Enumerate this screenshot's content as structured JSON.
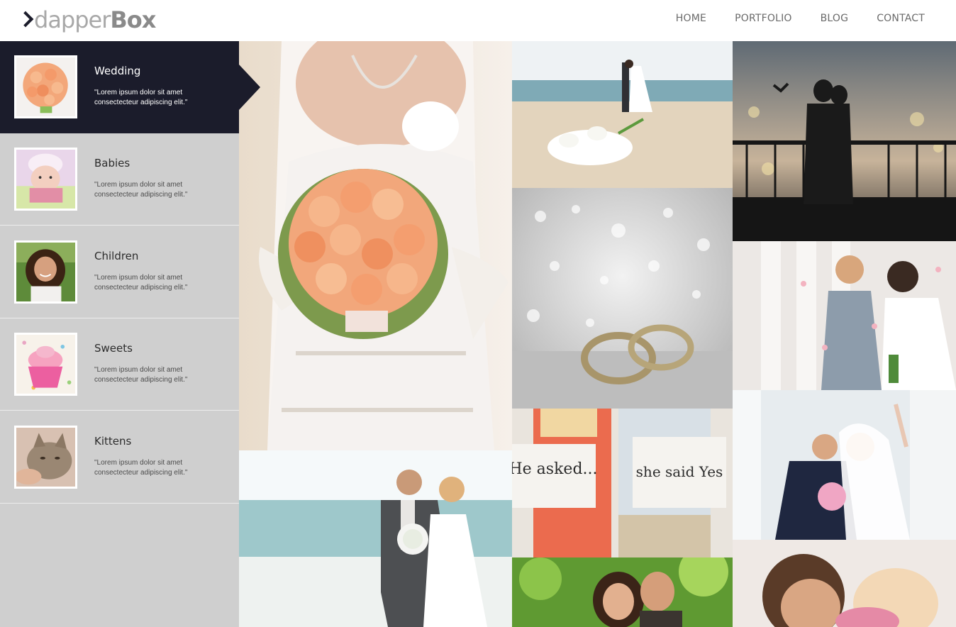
{
  "brand": {
    "prefix": "dapper",
    "suffix": "Box"
  },
  "nav": {
    "items": [
      "HOME",
      "PORTFOLIO",
      "BLOG",
      "CONTACT"
    ]
  },
  "categories": [
    {
      "title": "Wedding",
      "desc": "\"Lorem ipsum dolor sit amet consectecteur adipiscing elit.\"",
      "thumb_icon": "roses-bouquet-thumbnail"
    },
    {
      "title": "Babies",
      "desc": "\"Lorem ipsum dolor sit amet consectecteur adipiscing elit.\"",
      "thumb_icon": "baby-thumbnail"
    },
    {
      "title": "Children",
      "desc": "\"Lorem ipsum dolor sit amet consectecteur adipiscing elit.\"",
      "thumb_icon": "child-thumbnail"
    },
    {
      "title": "Sweets",
      "desc": "\"Lorem ipsum dolor sit amet consectecteur adipiscing elit.\"",
      "thumb_icon": "cupcake-thumbnail"
    },
    {
      "title": "Kittens",
      "desc": "\"Lorem ipsum dolor sit amet consectecteur adipiscing elit.\"",
      "thumb_icon": "kitten-thumbnail"
    }
  ],
  "active_category": "Wedding",
  "signs": {
    "left_sign": "He asked...",
    "right_sign": "she said Yes"
  },
  "colors": {
    "active_bg": "#1b1c2b",
    "sidebar_bg": "#cfcfcf",
    "nav_text": "#6a6a6a"
  }
}
